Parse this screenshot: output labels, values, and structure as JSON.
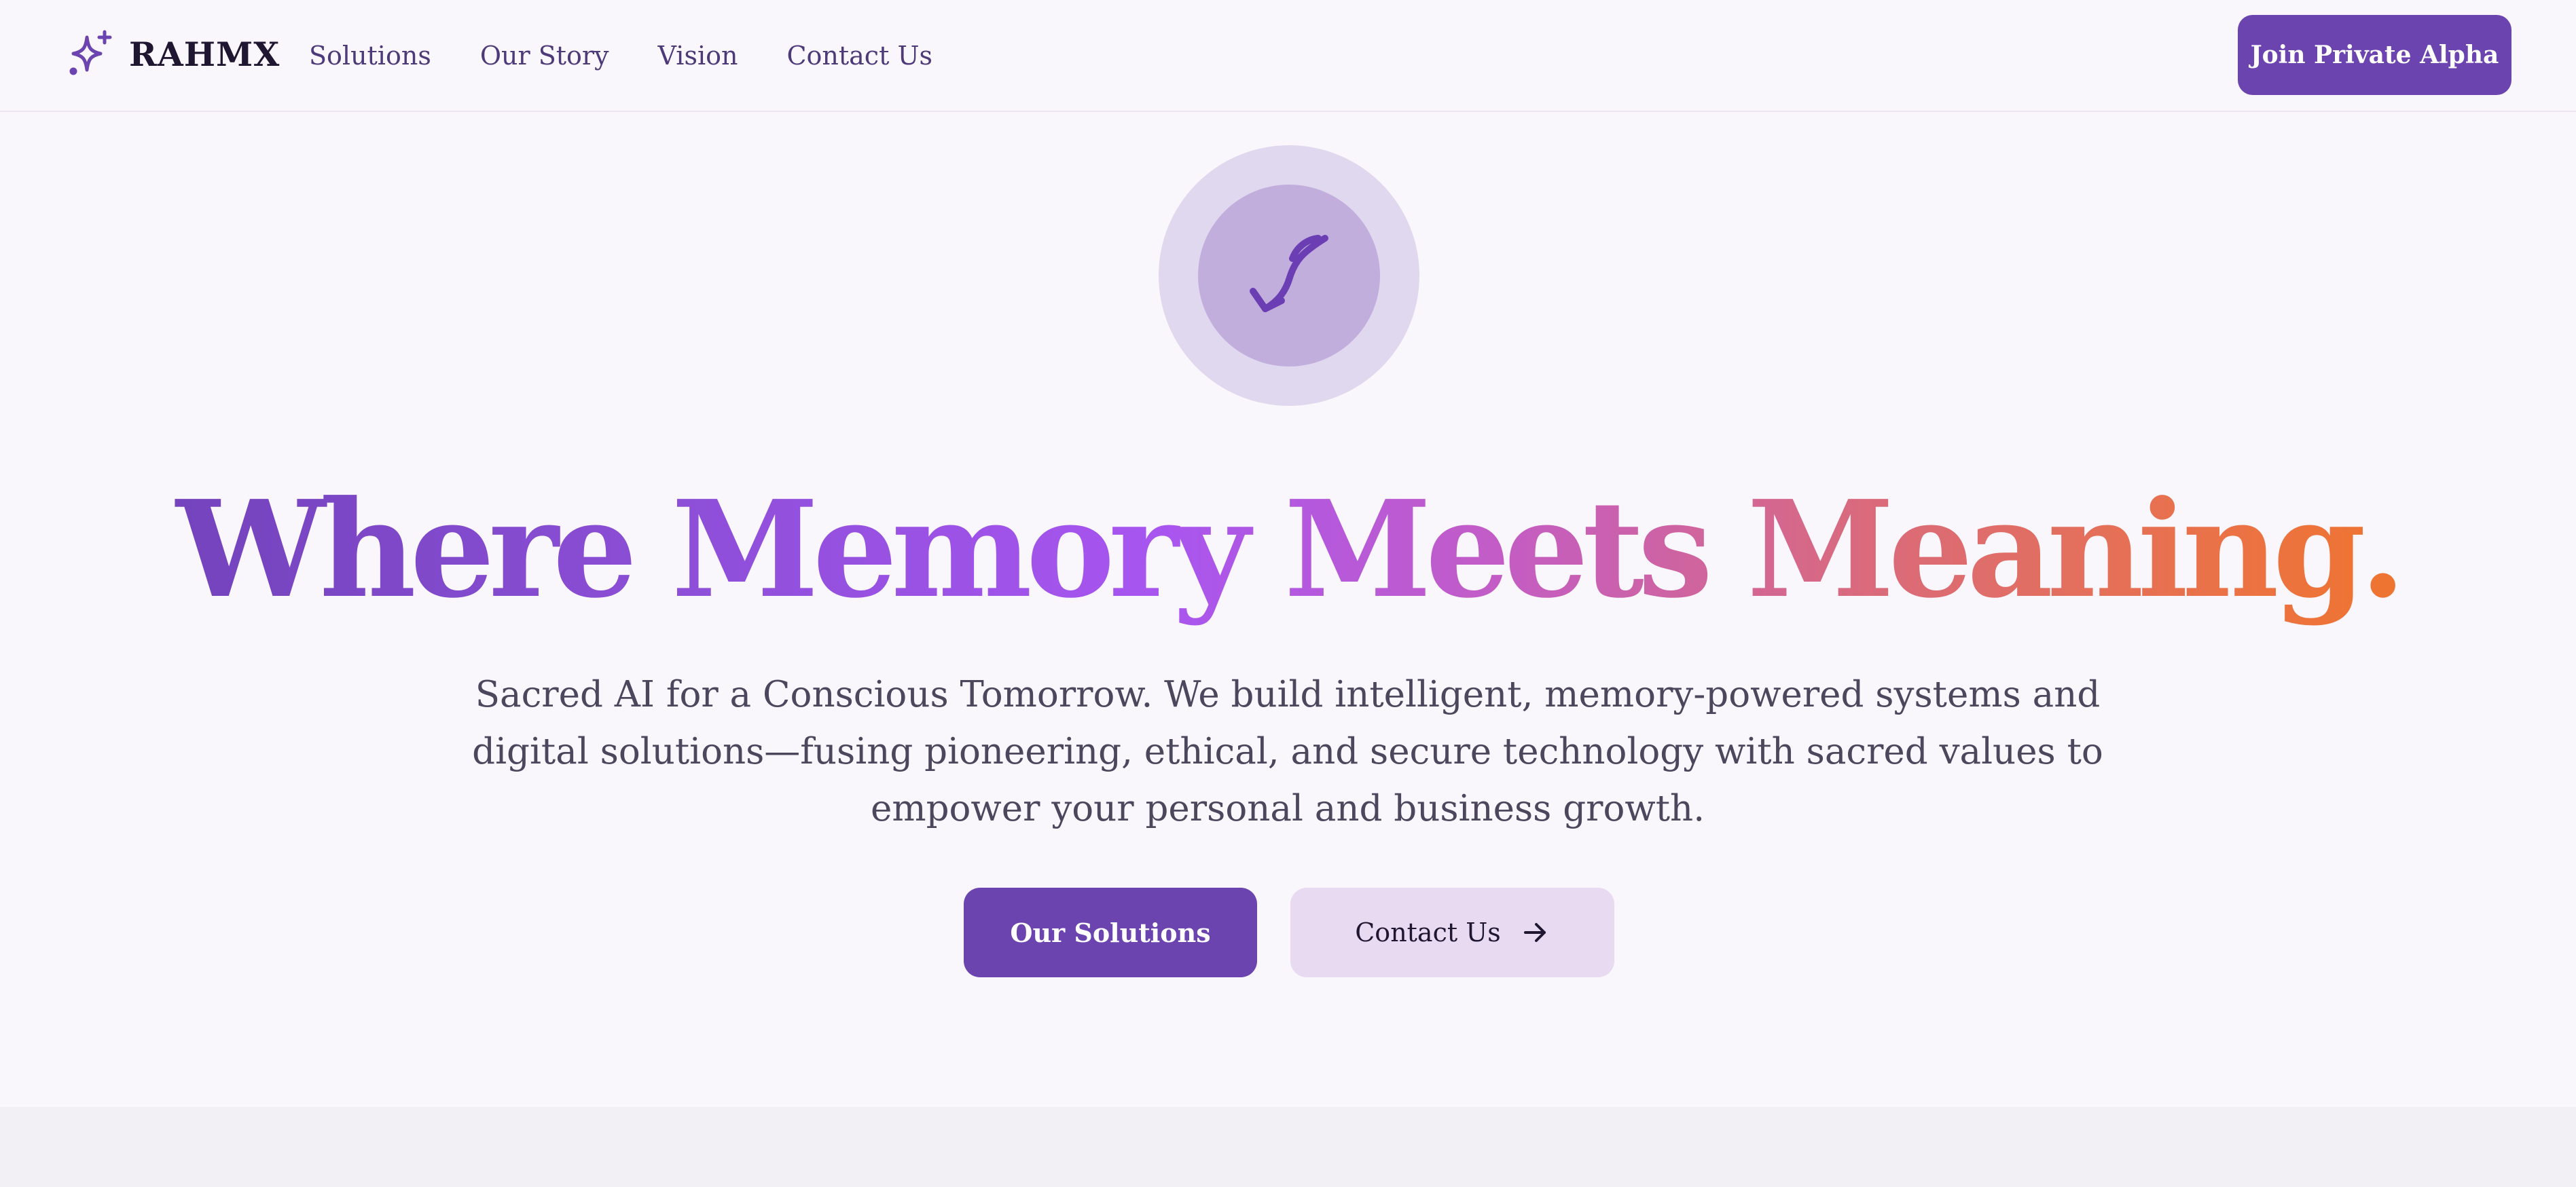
{
  "brand": {
    "name": "RAHMX",
    "logo_icon": "sparkle-icon",
    "accent_color": "#6b44b0"
  },
  "nav": {
    "links": [
      {
        "label": "Solutions"
      },
      {
        "label": "Our Story"
      },
      {
        "label": "Vision"
      },
      {
        "label": "Contact Us"
      }
    ],
    "cta_label": "Join Private Alpha"
  },
  "hero": {
    "badge_icon": "quill-icon",
    "headline_words": [
      "Where",
      "Memory",
      "Meets",
      "Meaning."
    ],
    "headline_gradient": [
      "#6b3fb3",
      "#a855f0",
      "#d96a7e",
      "#f2751a"
    ],
    "subtitle": "Sacred AI for a Conscious Tomorrow. We build intelligent, memory-powered systems and digital solutions—fusing pioneering, ethical, and secure technology with sacred values to empower your personal and business growth.",
    "primary_cta": "Our Solutions",
    "secondary_cta": "Contact Us",
    "secondary_cta_icon": "arrow-right-icon"
  }
}
